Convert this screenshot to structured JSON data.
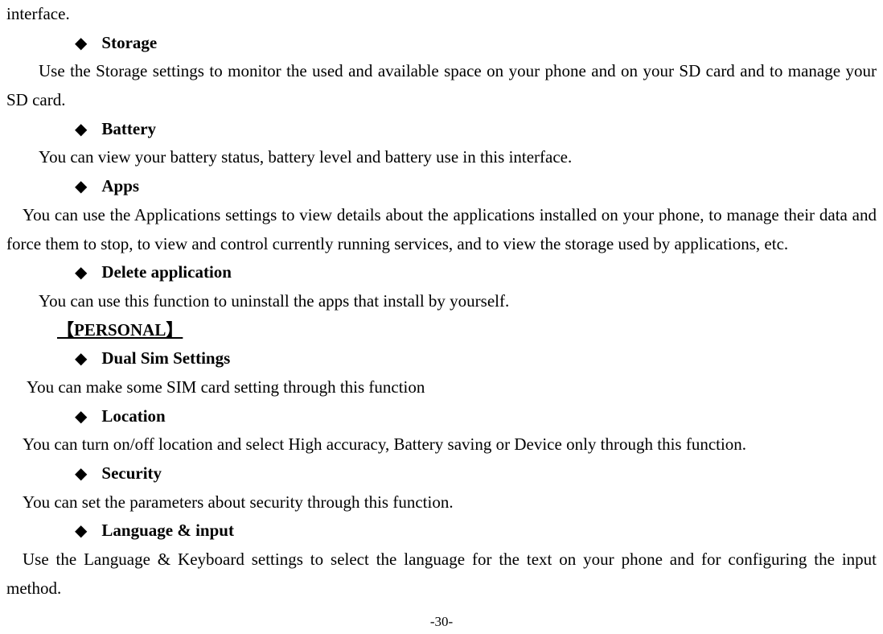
{
  "top_fragment": "interface.",
  "items": {
    "storage": {
      "label": "Storage",
      "desc": "Use the Storage settings to monitor the used and available space on your phone and on your SD card and to manage your SD card."
    },
    "battery": {
      "label": "Battery",
      "desc": "You can view your battery status, battery level and battery use in this interface."
    },
    "apps": {
      "label": "Apps",
      "desc": "You can use the Applications settings to view details about the applications installed on your phone, to manage their data and force them to stop, to view and control currently running services, and to view the storage used by applications, etc."
    },
    "delete_app": {
      "label": "Delete application",
      "desc": "You can use this function to uninstall the apps that install by yourself."
    },
    "section": "【PERSONAL】",
    "dual_sim": {
      "label": "Dual Sim Settings",
      "desc": "You can make some SIM card setting through this function"
    },
    "location": {
      "label": "Location",
      "desc": "You can turn on/off location and select High accuracy, Battery saving or Device only through this function."
    },
    "security": {
      "label": "Security",
      "desc": "You can set the parameters about security through this function."
    },
    "lang_input": {
      "label": "Language & input",
      "desc": "Use the Language & Keyboard settings to select the language for the text on your phone and for configuring the input method."
    }
  },
  "page_number": "-30-"
}
